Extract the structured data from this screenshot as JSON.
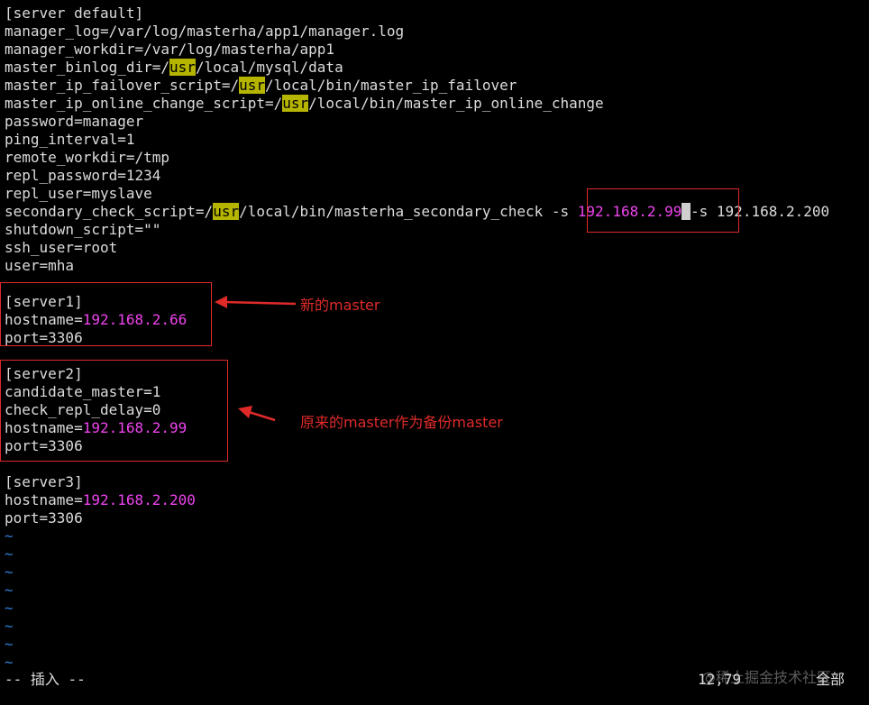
{
  "editor": {
    "lines": [
      [
        {
          "t": "[server default]"
        }
      ],
      [
        {
          "t": "manager_log=/var/log/masterha/app1/manager.log"
        }
      ],
      [
        {
          "t": "manager_workdir=/var/log/masterha/app1"
        }
      ],
      [
        {
          "t": "master_binlog_dir=/"
        },
        {
          "t": "usr",
          "s": "hl"
        },
        {
          "t": "/local/mysql/data"
        }
      ],
      [
        {
          "t": "master_ip_failover_script=/"
        },
        {
          "t": "usr",
          "s": "hl"
        },
        {
          "t": "/local/bin/master_ip_failover"
        }
      ],
      [
        {
          "t": "master_ip_online_change_script=/"
        },
        {
          "t": "usr",
          "s": "hl"
        },
        {
          "t": "/local/bin/master_ip_online_change"
        }
      ],
      [
        {
          "t": "password=manager"
        }
      ],
      [
        {
          "t": "ping_interval=1"
        }
      ],
      [
        {
          "t": "remote_workdir=/tmp"
        }
      ],
      [
        {
          "t": "repl_password=1234"
        }
      ],
      [
        {
          "t": "repl_user=myslave"
        }
      ],
      [
        {
          "t": "secondary_check_script=/"
        },
        {
          "t": "usr",
          "s": "hl"
        },
        {
          "t": "/local/bin/masterha_secondary_check -s "
        },
        {
          "t": "192.168.2.99",
          "s": "ip"
        },
        {
          "t": " ",
          "s": "cursor"
        },
        {
          "t": "-s 192.168.2.200"
        }
      ],
      [
        {
          "t": "shutdown_script=\"\""
        }
      ],
      [
        {
          "t": "ssh_user=root"
        }
      ],
      [
        {
          "t": "user=mha"
        }
      ],
      [
        {
          "t": ""
        }
      ],
      [
        {
          "t": "[server1]"
        }
      ],
      [
        {
          "t": "hostname="
        },
        {
          "t": "192.168.2.66",
          "s": "ip"
        }
      ],
      [
        {
          "t": "port=3306"
        }
      ],
      [
        {
          "t": ""
        }
      ],
      [
        {
          "t": "[server2]"
        }
      ],
      [
        {
          "t": "candidate_master=1"
        }
      ],
      [
        {
          "t": "check_repl_delay=0"
        }
      ],
      [
        {
          "t": "hostname="
        },
        {
          "t": "192.168.2.99",
          "s": "ip"
        }
      ],
      [
        {
          "t": "port=3306"
        }
      ],
      [
        {
          "t": ""
        }
      ],
      [
        {
          "t": "[server3]"
        }
      ],
      [
        {
          "t": "hostname="
        },
        {
          "t": "192.168.2.200",
          "s": "ip"
        }
      ],
      [
        {
          "t": "port=3306"
        }
      ],
      [
        {
          "t": "~",
          "s": "tilde"
        }
      ],
      [
        {
          "t": "~",
          "s": "tilde"
        }
      ],
      [
        {
          "t": "~",
          "s": "tilde"
        }
      ],
      [
        {
          "t": "~",
          "s": "tilde"
        }
      ],
      [
        {
          "t": "~",
          "s": "tilde"
        }
      ],
      [
        {
          "t": "~",
          "s": "tilde"
        }
      ],
      [
        {
          "t": "~",
          "s": "tilde"
        }
      ],
      [
        {
          "t": "~",
          "s": "tilde"
        }
      ]
    ]
  },
  "annotations": {
    "server1_note": "新的master",
    "server2_note": "原来的master作为备份master"
  },
  "status_bar": {
    "mode": "-- 插入 --",
    "cursor_position": "12,79",
    "scroll_position": "全部"
  },
  "watermark": "@稀土掘金技术社区",
  "colors": {
    "background": "#000000",
    "text": "#dcdcdc",
    "highlight_bg": "#b5b500",
    "ip_text": "#ee44ee",
    "tilde": "#2f7fd8",
    "annotation_red": "#e02a2a"
  }
}
